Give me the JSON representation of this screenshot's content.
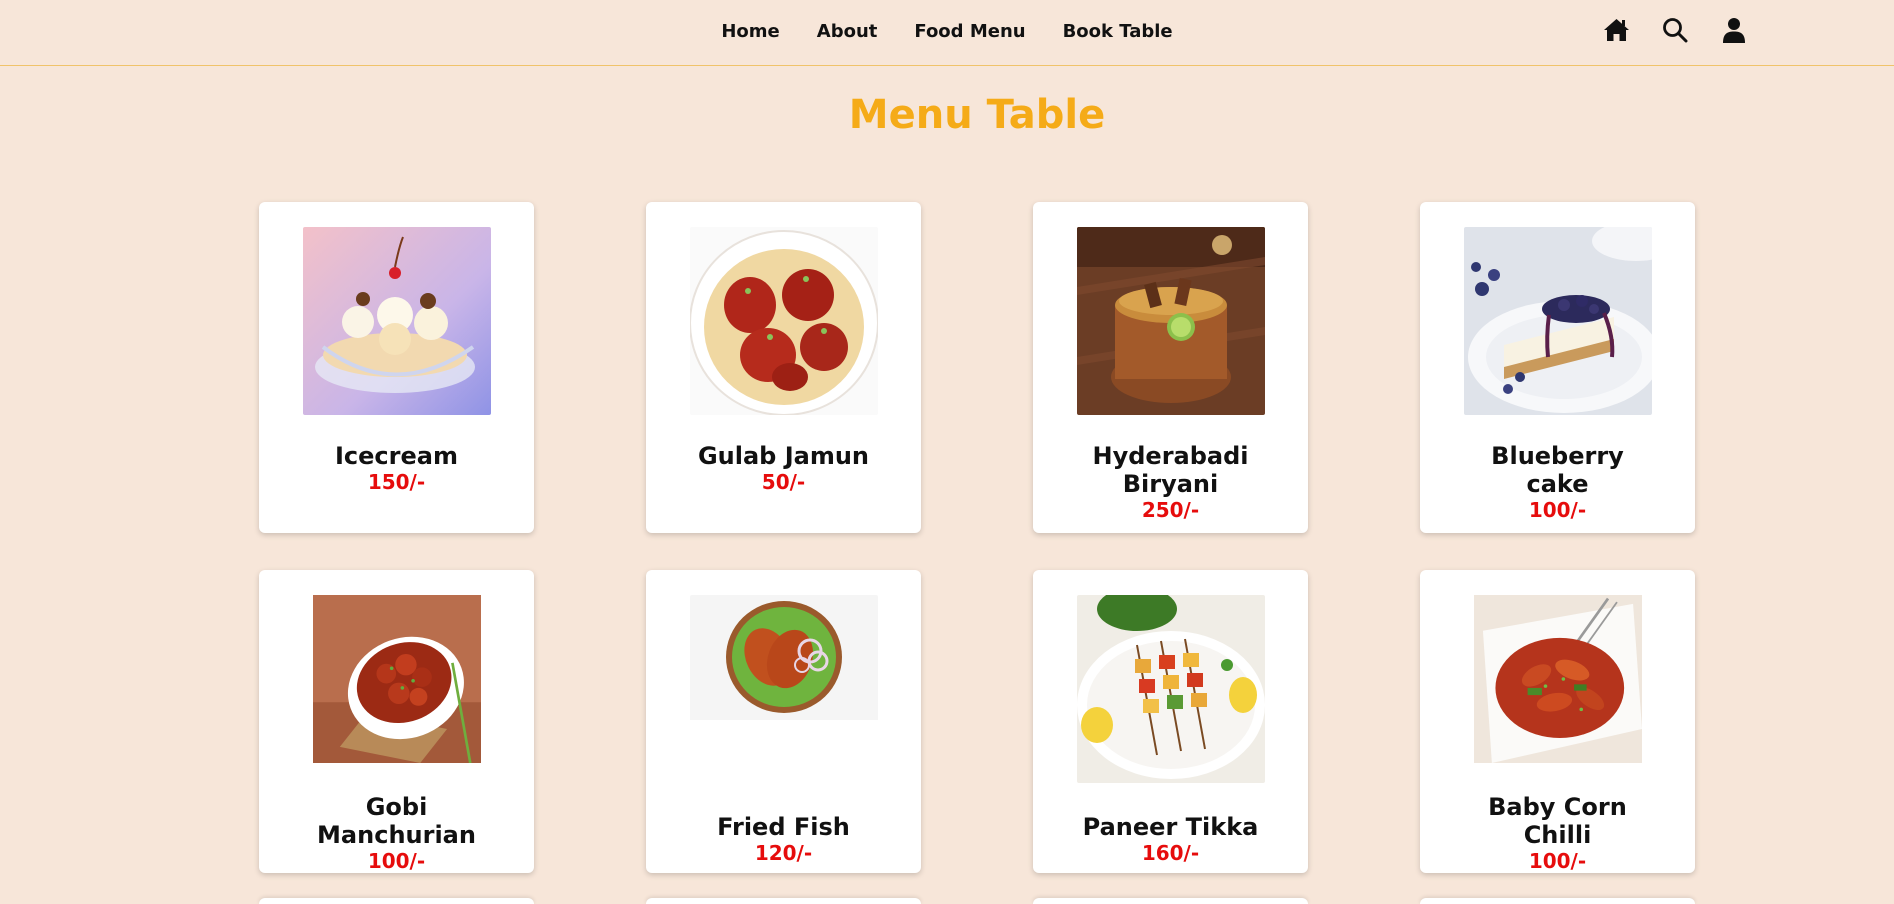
{
  "nav": {
    "links": [
      "Home",
      "About",
      "Food Menu",
      "Book Table"
    ],
    "icons": [
      "home-icon",
      "search-icon",
      "user-icon"
    ]
  },
  "page": {
    "title": "Menu Table"
  },
  "menu": [
    {
      "name": "Icecream",
      "price": "150/-",
      "image": "icecream-sundae"
    },
    {
      "name": "Gulab Jamun",
      "price": "50/-",
      "image": "gulab-jamun-bowl"
    },
    {
      "name": "Hyderabadi Biryani",
      "price": "250/-",
      "image": "biryani-pot"
    },
    {
      "name": "Blueberry cake",
      "price": "100/-",
      "image": "blueberry-cheesecake"
    },
    {
      "name": "Gobi Manchurian",
      "price": "100/-",
      "image": "gobi-manchurian-bowl"
    },
    {
      "name": "Fried Fish",
      "price": "120/-",
      "image": "fried-fish-plate"
    },
    {
      "name": "Paneer Tikka",
      "price": "160/-",
      "image": "paneer-tikka-skewers"
    },
    {
      "name": "Baby Corn Chilli",
      "price": "100/-",
      "image": "baby-corn-chilli-plate"
    }
  ],
  "colors": {
    "background": "#f7e6d9",
    "title": "#f5ab18",
    "price": "#e60c0c",
    "header_border": "#f0c36a"
  }
}
